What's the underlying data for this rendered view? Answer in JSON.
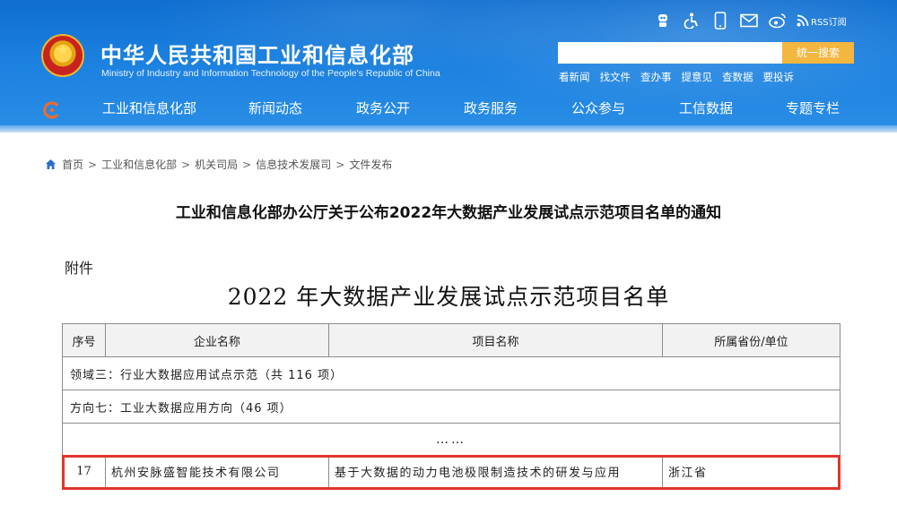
{
  "header": {
    "ministry_name_cn": "中华人民共和国工业和信息化部",
    "ministry_name_en": "Ministry of Industry and Information Technology of the People's Republic of China",
    "icons": [
      "robot-icon",
      "accessibility-icon",
      "mobile-icon",
      "mail-icon",
      "weibo-icon",
      "rss-icon"
    ],
    "rss_label": "RSS订阅",
    "search": {
      "placeholder": "",
      "button_label": "统一搜索"
    },
    "quick_links": [
      "看新闻",
      "找文件",
      "查办事",
      "提意见",
      "查数据",
      "要投诉"
    ],
    "nav": [
      "工业和信息化部",
      "新闻动态",
      "政务公开",
      "政务服务",
      "公众参与",
      "工信数据",
      "专题专栏"
    ]
  },
  "breadcrumb": [
    "首页",
    "工业和信息化部",
    "机关司局",
    "信息技术发展司",
    "文件发布"
  ],
  "article": {
    "title": "工业和信息化部办公厅关于公布2022年大数据产业发展试点示范项目名单的通知",
    "attachment_label": "附件",
    "doc_title": "2022 年大数据产业发展试点示范项目名单"
  },
  "table": {
    "headers": [
      "序号",
      "企业名称",
      "项目名称",
      "所属省份/单位"
    ],
    "domain_row": "领域三：行业大数据应用试点示范（共 116 项）",
    "direction_row": "方向七：工业大数据应用方向（46 项）",
    "ellipsis": "……",
    "rows": [
      {
        "no": "17",
        "company": "杭州安脉盛智能技术有限公司",
        "project": "基于大数据的动力电池极限制造技术的研发与应用",
        "province": "浙江省"
      }
    ]
  },
  "colors": {
    "header_blue": "#1b80df",
    "search_button": "#f3b63f",
    "highlight_border": "#e1362c"
  }
}
